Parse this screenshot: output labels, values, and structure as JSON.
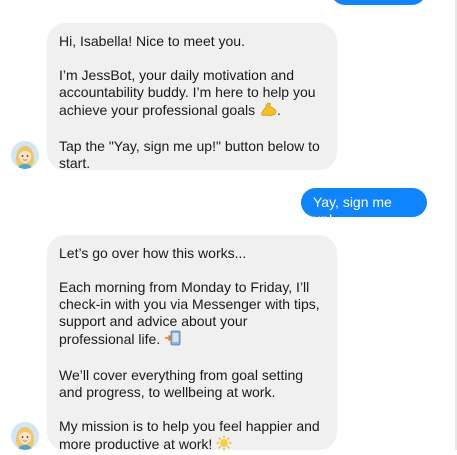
{
  "messages": {
    "m0": {
      "from": "user",
      "text": ""
    },
    "m1": {
      "from": "bot",
      "p1": "Hi, Isabella! Nice to meet you.",
      "p2": "I’m JessBot, your daily motivation and accountability buddy. I’m here to help you achieve your professional goals",
      "p2_emoji": "flexed-biceps-icon",
      "p2_after": ".",
      "p3": "Tap the \"Yay, sign me up!\" button below to start."
    },
    "m2": {
      "from": "user",
      "text": "Yay, sign me up!"
    },
    "m3": {
      "from": "bot",
      "p1": "Let’s go over how this works...",
      "p2": "Each morning from Monday to Friday, I’ll check-in with you via Messenger with tips, support and advice about your professional life.",
      "p2_emoji": "mobile-arrow-icon",
      "p3": "We’ll cover everything from goal setting and progress, to wellbeing at work.",
      "p4": "My mission is to help you feel happier and more productive at work!",
      "p4_emoji": "sun-icon"
    }
  },
  "colors": {
    "user_bubble": "#0f84ff",
    "bot_bubble": "#f1f0f0",
    "text": "#1a1a1a"
  }
}
